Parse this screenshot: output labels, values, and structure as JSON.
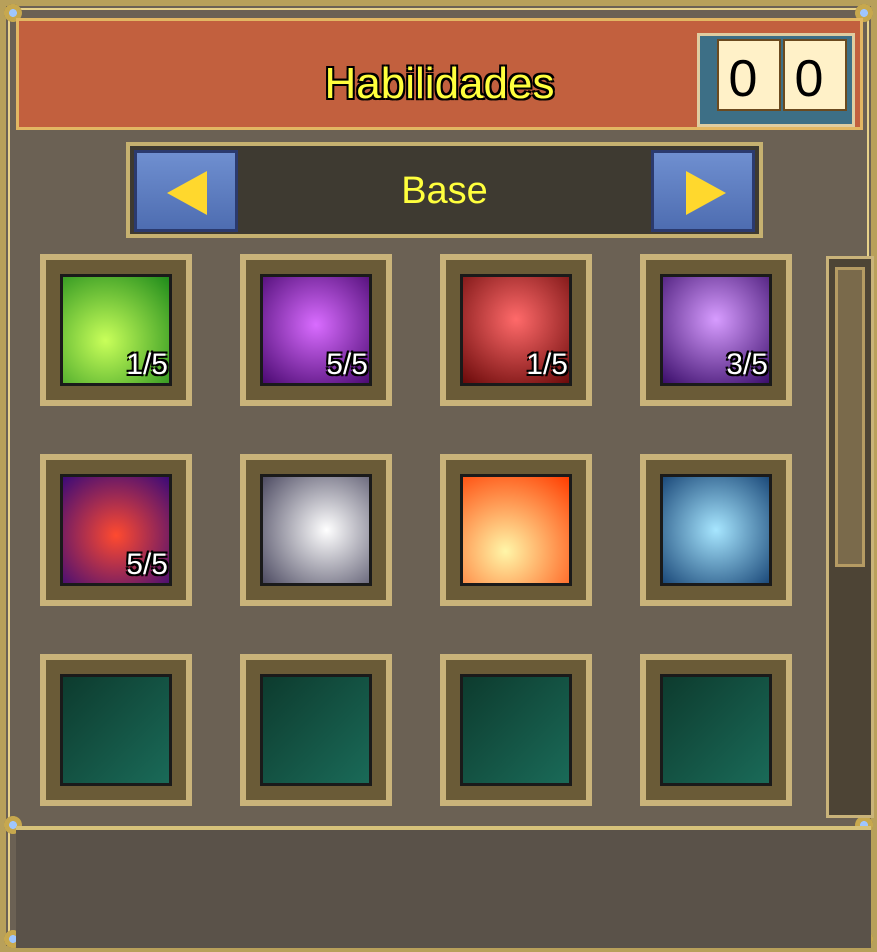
{
  "window": {
    "title": "Habilidades"
  },
  "counter": {
    "digits": [
      "0",
      "0"
    ]
  },
  "tab": {
    "label": "Base"
  },
  "skills": [
    {
      "label": "1/5",
      "icon": "green-cross-icon"
    },
    {
      "label": "5/5",
      "icon": "purple-demon-icon"
    },
    {
      "label": "1/5",
      "icon": "red-beam-icon"
    },
    {
      "label": "3/5",
      "icon": "purple-smoke-icon"
    },
    {
      "label": "5/5",
      "icon": "red-cloak-icon"
    },
    {
      "label": "",
      "icon": "unicorn-icon"
    },
    {
      "label": "",
      "icon": "fire-hand-icon"
    },
    {
      "label": "",
      "icon": "blue-shield-icon"
    },
    {
      "label": "",
      "icon": "sword-icon"
    },
    {
      "label": "",
      "icon": "axe-icon"
    },
    {
      "label": "",
      "icon": "axe-icon"
    },
    {
      "label": "",
      "icon": "hammer-icon"
    }
  ],
  "colors": {
    "title": "#ffff3d",
    "titlebar": "#c2603e",
    "frame": "#c9b37a"
  }
}
